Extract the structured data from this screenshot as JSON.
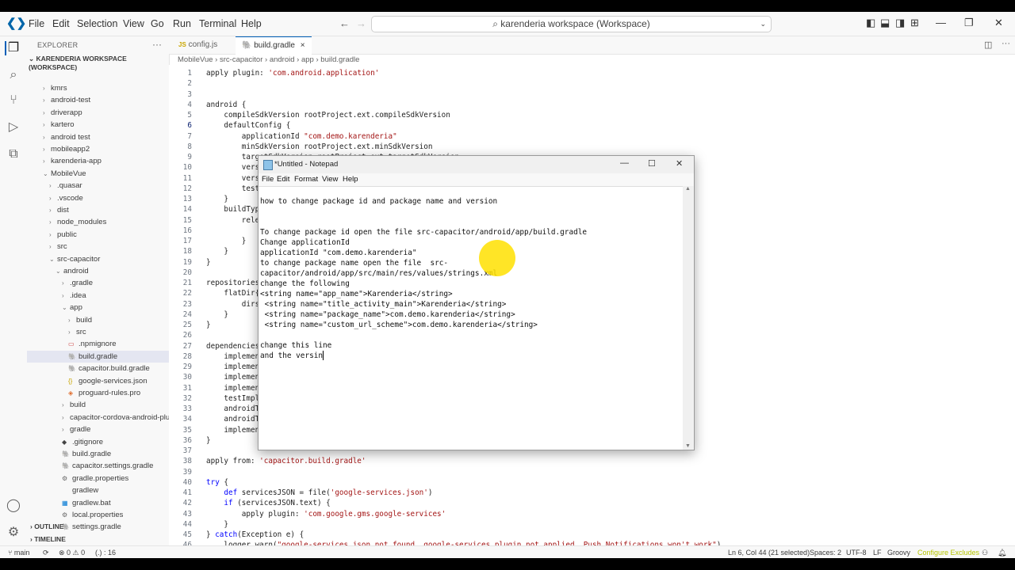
{
  "titlebar": {
    "menus": [
      "File",
      "Edit",
      "Selection",
      "View",
      "Go",
      "Run",
      "Terminal",
      "Help"
    ],
    "search_text": "karenderia workspace (Workspace)"
  },
  "sidebar": {
    "title": "EXPLORER",
    "more": "···",
    "workspace": "KARENDERIA WORKSPACE (WORKSPACE)",
    "items": [
      {
        "label": "kmrs",
        "depth": 1,
        "type": "folder",
        "open": false
      },
      {
        "label": "android-test",
        "depth": 1,
        "type": "folder",
        "open": false
      },
      {
        "label": "driverapp",
        "depth": 1,
        "type": "folder",
        "open": false
      },
      {
        "label": "kartero",
        "depth": 1,
        "type": "folder",
        "open": false
      },
      {
        "label": "android test",
        "depth": 1,
        "type": "folder",
        "open": false
      },
      {
        "label": "mobileapp2",
        "depth": 1,
        "type": "folder",
        "open": false
      },
      {
        "label": "karenderia-app",
        "depth": 1,
        "type": "folder",
        "open": false
      },
      {
        "label": "MobileVue",
        "depth": 1,
        "type": "folder",
        "open": true
      },
      {
        "label": ".quasar",
        "depth": 2,
        "type": "folder",
        "open": false
      },
      {
        "label": ".vscode",
        "depth": 2,
        "type": "folder",
        "open": false
      },
      {
        "label": "dist",
        "depth": 2,
        "type": "folder",
        "open": false
      },
      {
        "label": "node_modules",
        "depth": 2,
        "type": "folder",
        "open": false
      },
      {
        "label": "public",
        "depth": 2,
        "type": "folder",
        "open": false
      },
      {
        "label": "src",
        "depth": 2,
        "type": "folder",
        "open": false
      },
      {
        "label": "src-capacitor",
        "depth": 2,
        "type": "folder",
        "open": true
      },
      {
        "label": "android",
        "depth": 3,
        "type": "folder",
        "open": true
      },
      {
        "label": ".gradle",
        "depth": 4,
        "type": "folder",
        "open": false
      },
      {
        "label": ".idea",
        "depth": 4,
        "type": "folder",
        "open": false
      },
      {
        "label": "app",
        "depth": 4,
        "type": "folder",
        "open": true
      },
      {
        "label": "build",
        "depth": 5,
        "type": "folder",
        "open": false
      },
      {
        "label": "src",
        "depth": 5,
        "type": "folder",
        "open": false
      },
      {
        "label": ".npmignore",
        "depth": 5,
        "type": "file",
        "icon": "npm"
      },
      {
        "label": "build.gradle",
        "depth": 5,
        "type": "file",
        "icon": "gradle",
        "selected": true
      },
      {
        "label": "capacitor.build.gradle",
        "depth": 5,
        "type": "file",
        "icon": "gradle"
      },
      {
        "label": "google-services.json",
        "depth": 5,
        "type": "file",
        "icon": "json"
      },
      {
        "label": "proguard-rules.pro",
        "depth": 5,
        "type": "file",
        "icon": "shield"
      },
      {
        "label": "build",
        "depth": 4,
        "type": "folder",
        "open": false
      },
      {
        "label": "capacitor-cordova-android-plugi...",
        "depth": 4,
        "type": "folder",
        "open": false
      },
      {
        "label": "gradle",
        "depth": 4,
        "type": "folder",
        "open": false
      },
      {
        "label": ".gitignore",
        "depth": 4,
        "type": "file",
        "icon": "git"
      },
      {
        "label": "build.gradle",
        "depth": 4,
        "type": "file",
        "icon": "gradle"
      },
      {
        "label": "capacitor.settings.gradle",
        "depth": 4,
        "type": "file",
        "icon": "gradle"
      },
      {
        "label": "gradle.properties",
        "depth": 4,
        "type": "file",
        "icon": "gear"
      },
      {
        "label": "gradlew",
        "depth": 4,
        "type": "file",
        "icon": "none"
      },
      {
        "label": "gradlew.bat",
        "depth": 4,
        "type": "file",
        "icon": "win"
      },
      {
        "label": "local.properties",
        "depth": 4,
        "type": "file",
        "icon": "gear"
      },
      {
        "label": "settings.gradle",
        "depth": 4,
        "type": "file",
        "icon": "gradle"
      }
    ],
    "outline": "OUTLINE",
    "timeline": "TIMELINE"
  },
  "tabs": [
    {
      "label": "config.js",
      "icon": "JS",
      "active": false
    },
    {
      "label": "build.gradle",
      "icon": "gradle",
      "active": true,
      "close": "×"
    }
  ],
  "breadcrumb": [
    "MobileVue",
    "src-capacitor",
    "android",
    "app",
    "build.gradle"
  ],
  "code_lines": [
    {
      "n": 1,
      "t": "apply plugin: 'com.android.application'"
    },
    {
      "n": 2,
      "t": ""
    },
    {
      "n": 3,
      "t": ""
    },
    {
      "n": 4,
      "t": "android {"
    },
    {
      "n": 5,
      "t": "    compileSdkVersion rootProject.ext.compileSdkVersion"
    },
    {
      "n": 6,
      "t": "    defaultConfig {"
    },
    {
      "n": 7,
      "t": "        applicationId \"com.demo.karenderia\""
    },
    {
      "n": 8,
      "t": "        minSdkVersion rootProject.ext.minSdkVersion"
    },
    {
      "n": 9,
      "t": "        targetSdkVersion rootProject.ext.targetSdkVersion"
    },
    {
      "n": 10,
      "t": "        versionCode 1"
    },
    {
      "n": 11,
      "t": "        versionName \"1.0\""
    },
    {
      "n": 12,
      "t": "        test"
    },
    {
      "n": 13,
      "t": "    }"
    },
    {
      "n": 14,
      "t": "    buildTyp"
    },
    {
      "n": 15,
      "t": "        rele"
    },
    {
      "n": 16,
      "t": ""
    },
    {
      "n": 17,
      "t": "        }"
    },
    {
      "n": 18,
      "t": "    }"
    },
    {
      "n": 19,
      "t": "}"
    },
    {
      "n": 20,
      "t": ""
    },
    {
      "n": 21,
      "t": "repositories"
    },
    {
      "n": 22,
      "t": "    flatDir{"
    },
    {
      "n": 23,
      "t": "        dirs"
    },
    {
      "n": 24,
      "t": "    }"
    },
    {
      "n": 25,
      "t": "}"
    },
    {
      "n": 26,
      "t": ""
    },
    {
      "n": 27,
      "t": "dependencies"
    },
    {
      "n": 28,
      "t": "    implemen"
    },
    {
      "n": 29,
      "t": "    implemen"
    },
    {
      "n": 30,
      "t": "    implemen"
    },
    {
      "n": 31,
      "t": "    implemen"
    },
    {
      "n": 32,
      "t": "    testImpl"
    },
    {
      "n": 33,
      "t": "    androidT"
    },
    {
      "n": 34,
      "t": "    androidT"
    },
    {
      "n": 35,
      "t": "    implemen"
    },
    {
      "n": 36,
      "t": "}"
    },
    {
      "n": 37,
      "t": ""
    },
    {
      "n": 38,
      "t": "apply from: 'capacitor.build.gradle'"
    },
    {
      "n": 39,
      "t": ""
    },
    {
      "n": 40,
      "t": "try {"
    },
    {
      "n": 41,
      "t": "    def servicesJSON = file('google-services.json')"
    },
    {
      "n": 42,
      "t": "    if (servicesJSON.text) {"
    },
    {
      "n": 43,
      "t": "        apply plugin: 'com.google.gms.google-services'"
    },
    {
      "n": 44,
      "t": "    }"
    },
    {
      "n": 45,
      "t": "} catch(Exception e) {"
    },
    {
      "n": 46,
      "t": "    logger.warn(\"google-services.json not found, google-services plugin not applied. Push Notifications won't work\")"
    }
  ],
  "notepad": {
    "title": "*Untitled - Notepad",
    "menus": [
      "File",
      "Edit",
      "Format",
      "View",
      "Help"
    ],
    "lines": [
      "how to change package id and package name and version",
      "",
      "",
      "To change package id open the file src-capacitor/android/app/build.gradle",
      "Change applicationId",
      "applicationId \"com.demo.karenderia\"",
      "to change package name open the file  src-",
      "capacitor/android/app/src/main/res/values/strings.xml",
      "change the following",
      "<string name=\"app_name\">Karenderia</string>",
      " <string name=\"title_activity_main\">Karenderia</string>",
      " <string name=\"package_name\">com.demo.karenderia</string>",
      " <string name=\"custom_url_scheme\">com.demo.karenderia</string>",
      "",
      "change this line",
      "and the versin"
    ]
  },
  "status": {
    "branch": "main",
    "errors": "⊗ 0 ⚠ 0",
    "ports": "(.) : 16",
    "position": "Ln 6, Col 44 (21 selected)",
    "spaces": "Spaces: 2",
    "encoding": "UTF-8",
    "eol": "LF",
    "language": "Groovy",
    "exclude": "Configure Excludes"
  },
  "colors": {
    "accent": "#005fb8",
    "selection": "#e4e6f1",
    "string": "#a31515",
    "excludes": "#b5c400"
  }
}
